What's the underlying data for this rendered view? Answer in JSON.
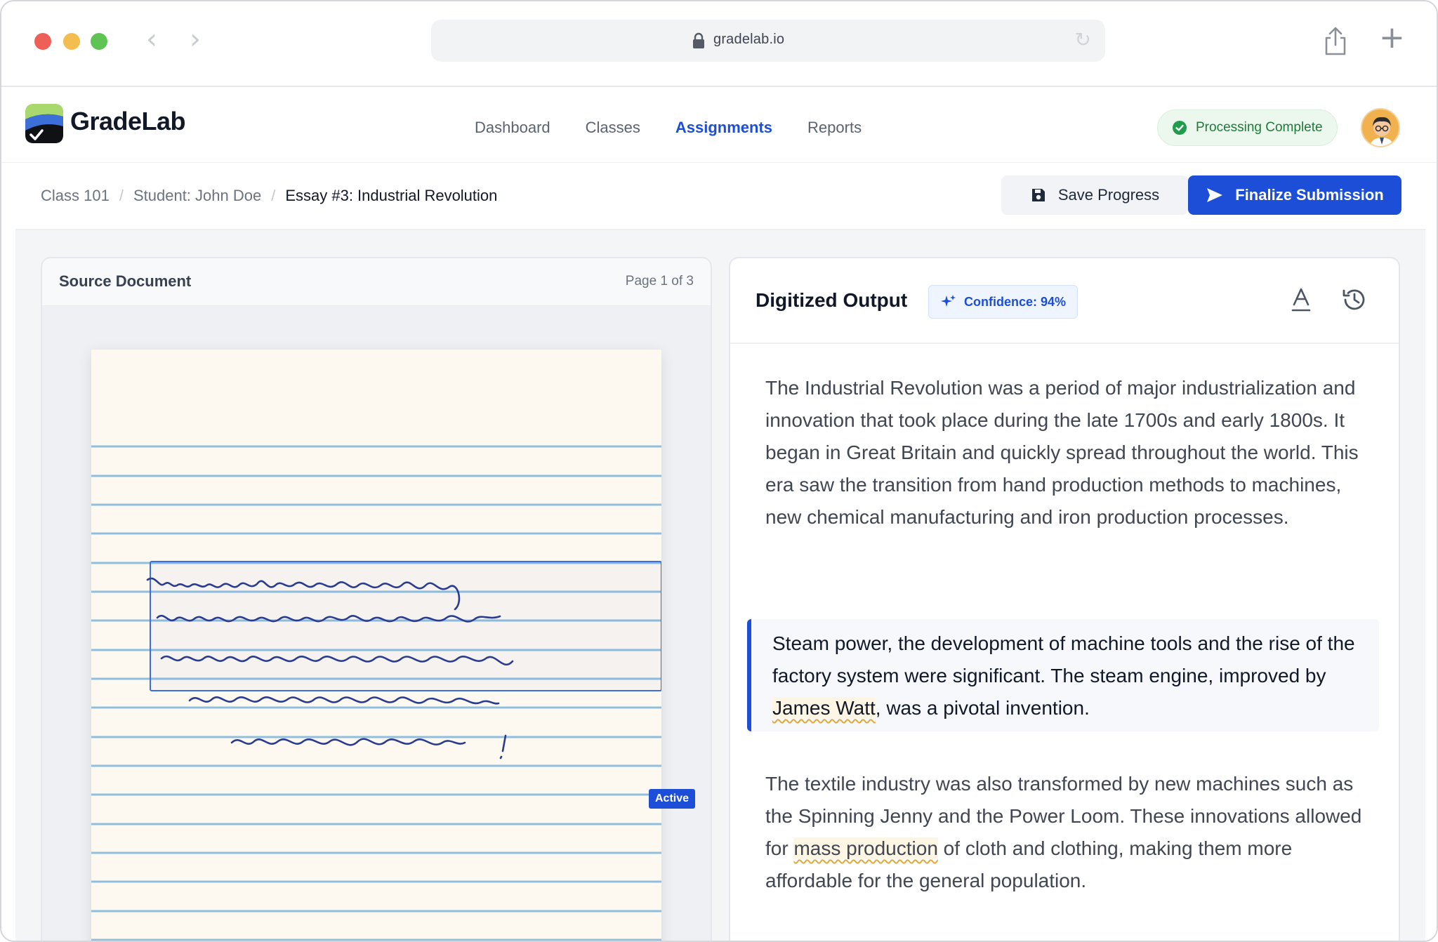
{
  "browser": {
    "url": "gradelab.io"
  },
  "app": {
    "brand": "GradeLab",
    "nav": [
      {
        "label": "Dashboard",
        "active": false
      },
      {
        "label": "Classes",
        "active": false
      },
      {
        "label": "Assignments",
        "active": true
      },
      {
        "label": "Reports",
        "active": false
      }
    ],
    "status": "Processing Complete"
  },
  "breadcrumb": {
    "items": [
      "Class 101",
      "Student: John Doe",
      "Essay #3: Industrial Revolution"
    ]
  },
  "actions": {
    "save_label": "Save Progress",
    "finalize_label": "Finalize Submission"
  },
  "source_panel": {
    "title": "Source Document",
    "page_indicator": "Page 1 of 3",
    "active_badge": "Active"
  },
  "output_panel": {
    "title": "Digitized Output",
    "confidence": "Confidence: 94%",
    "paragraphs": [
      {
        "text": "The Industrial Revolution was a period of major industrialization and innovation that took place during the late 1700s and early 1800s. It began in Great Britain and quickly spread throughout the world. This era saw the transition from hand production methods to machines, new chemical manufacturing and iron production processes."
      },
      {
        "before": "Steam power, the development of machine tools and the rise of the factory system were significant. The steam engine, improved by ",
        "highlight": "James Watt",
        "after": ", was a pivotal invention."
      },
      {
        "before": "The textile industry was also transformed by new machines such as the Spinning Jenny and the Power Loom. These innovations allowed for ",
        "highlight": "mass production",
        "after": " of cloth and clothing, making them more affordable for the general population."
      }
    ]
  },
  "colors": {
    "accent": "#1d4ed8",
    "success": "#1f7a3a",
    "paper": "#fdf8f0",
    "ruled_line": "#8fbfdc",
    "ink": "#2a3c8f"
  }
}
